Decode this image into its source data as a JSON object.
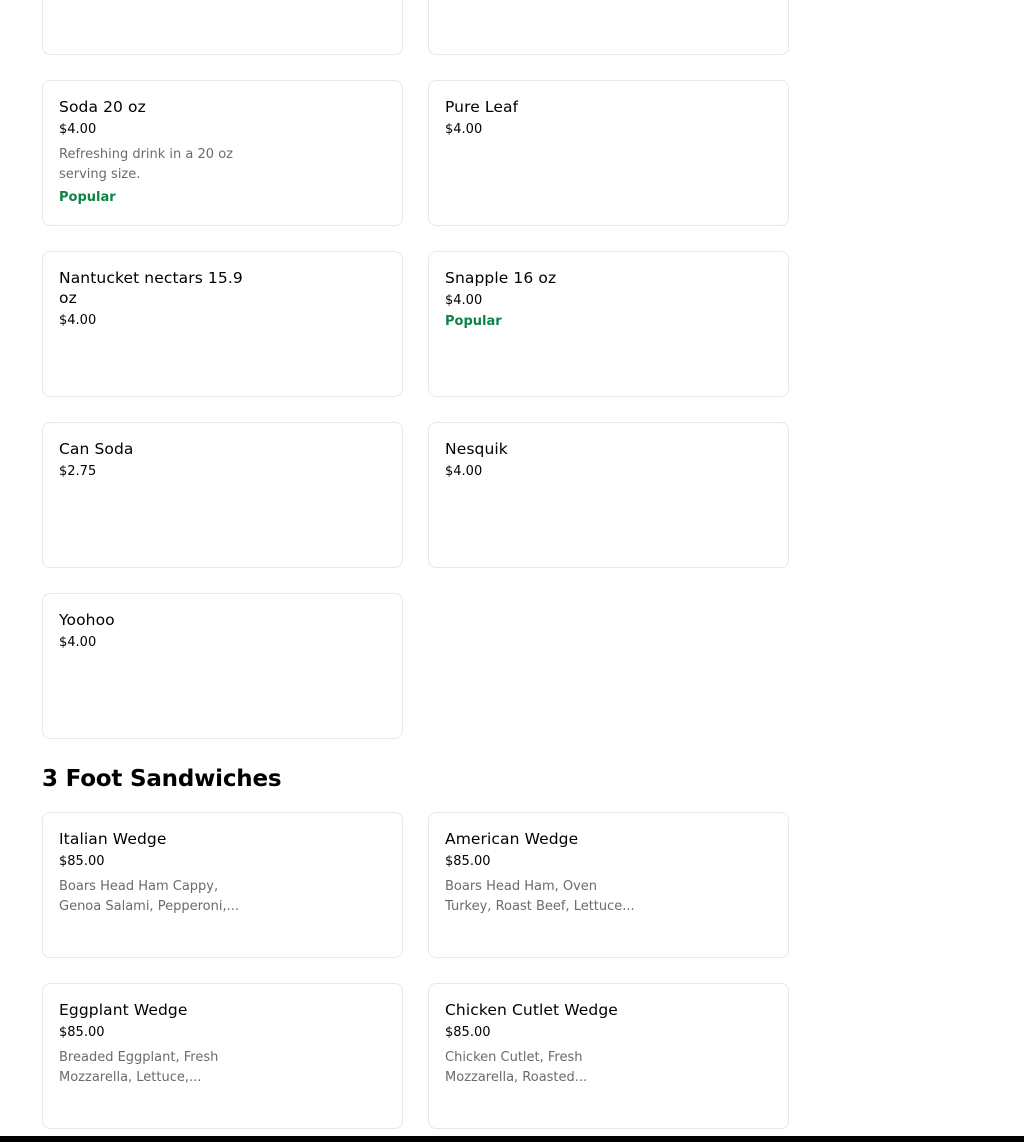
{
  "sections": [
    {
      "title": "",
      "items": [
        {
          "name": "",
          "price": ""
        },
        {
          "name": "",
          "price": ""
        },
        {
          "name": "Soda 20 oz",
          "price": "$4.00",
          "description": "Refreshing drink in a 20 oz serving size.",
          "badge": "Popular"
        },
        {
          "name": "Pure Leaf",
          "price": "$4.00"
        },
        {
          "name": "Nantucket nectars 15.9 oz",
          "price": "$4.00"
        },
        {
          "name": "Snapple 16 oz",
          "price": "$4.00",
          "badge": "Popular"
        },
        {
          "name": "Can Soda",
          "price": "$2.75"
        },
        {
          "name": "Nesquik",
          "price": "$4.00"
        },
        {
          "name": "Yoohoo",
          "price": "$4.00"
        }
      ]
    },
    {
      "title": "3 Foot Sandwiches",
      "items": [
        {
          "name": "Italian Wedge",
          "price": "$85.00",
          "description": "Boars Head Ham Cappy, Genoa Salami, Pepperoni,..."
        },
        {
          "name": "American Wedge",
          "price": "$85.00",
          "description": "Boars Head Ham, Oven Turkey, Roast Beef, Lettuce..."
        },
        {
          "name": "Eggplant Wedge",
          "price": "$85.00",
          "description": "Breaded Eggplant, Fresh Mozzarella, Lettuce,..."
        },
        {
          "name": "Chicken Cutlet Wedge",
          "price": "$85.00",
          "description": "Chicken Cutlet, Fresh Mozzarella, Roasted..."
        }
      ]
    }
  ],
  "colors": {
    "popular": "#0e8345",
    "description": "#6b6b6b",
    "border": "#e8e8e8"
  }
}
